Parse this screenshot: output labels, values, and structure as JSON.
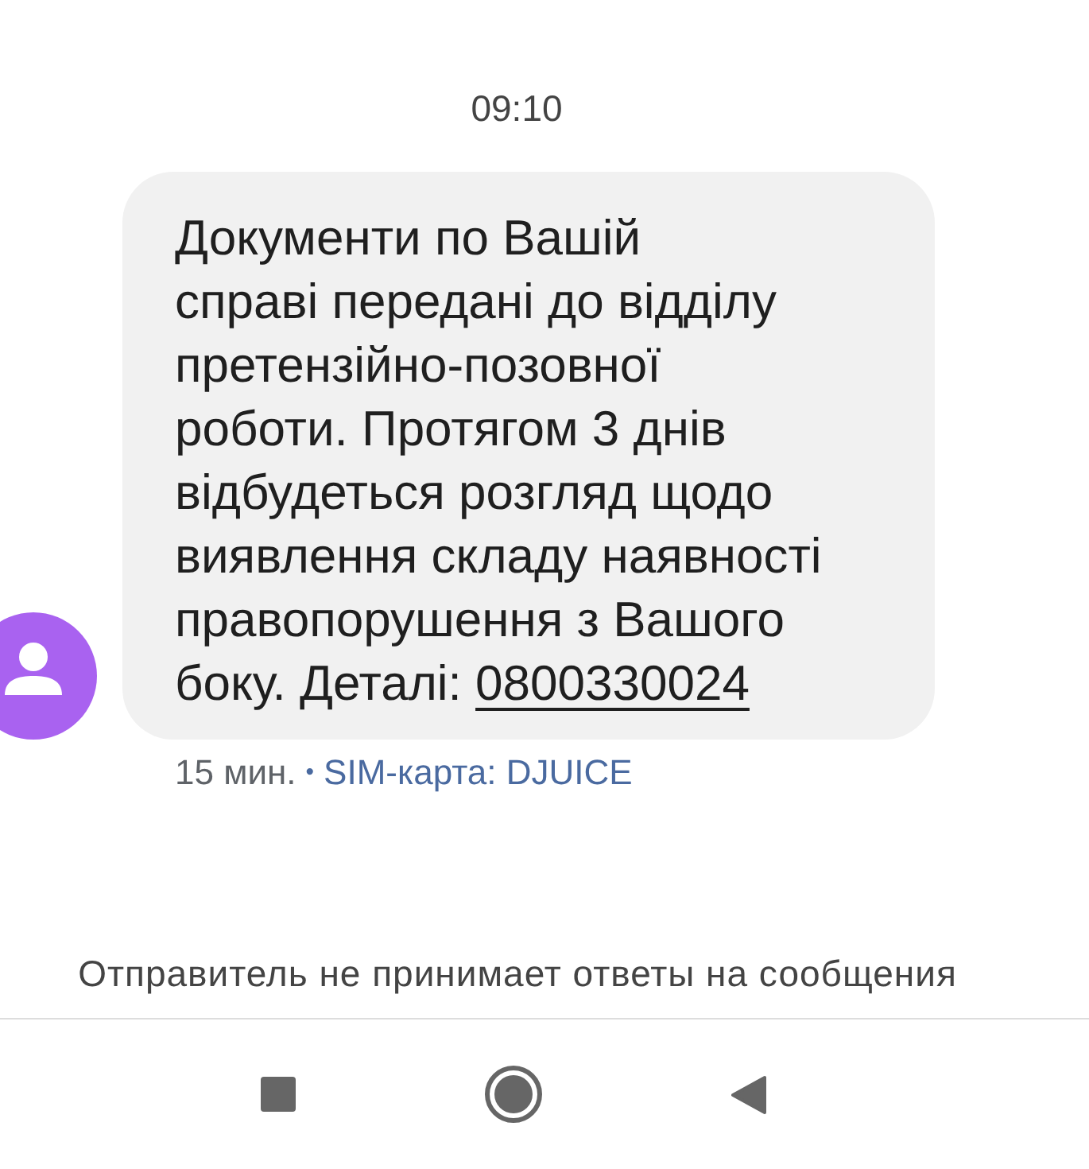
{
  "timestamp": "09:10",
  "message": {
    "text": "Документи по Вашій\nсправі передані до відділу претензійно-позовної роботи. Протягом 3 днів відбудеться розгляд щодо виявлення складу наявності правопорушення з Вашого боку. Деталі:",
    "link": "0800330024",
    "time": "15 мин.",
    "separator": "•",
    "sim": "SIM-карта: DJUICE"
  },
  "notice": "Отправитель не принимает ответы на сообщения",
  "nav_bar": {
    "buttons": [
      {
        "kind": "recents"
      },
      {
        "kind": "home"
      },
      {
        "kind": "back"
      }
    ]
  }
}
